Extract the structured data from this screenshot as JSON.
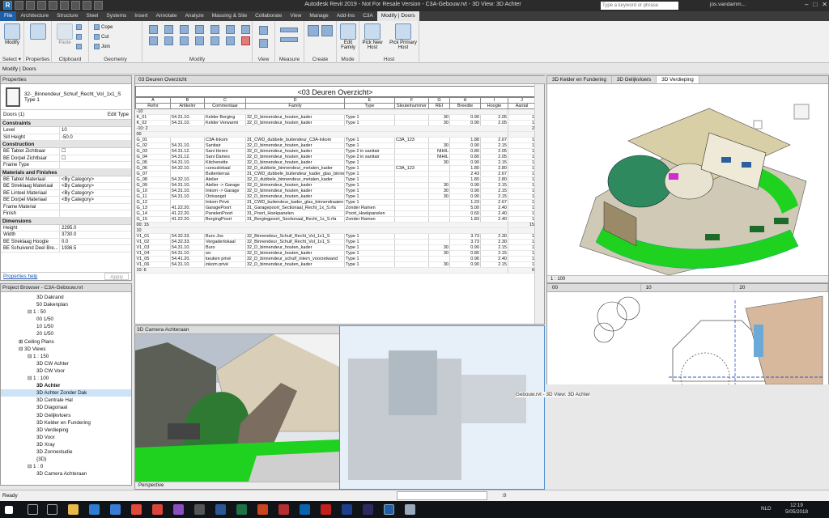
{
  "titlebar": {
    "title": "Autodesk Revit 2019 - Not For Resale Version - C3A-Gebouw.rvt - 3D View: 3D Achter",
    "search_placeholder": "Type a keyword or phrase",
    "user": "jos.vandamm..."
  },
  "tabs": [
    "File",
    "Architecture",
    "Structure",
    "Steel",
    "Systems",
    "Insert",
    "Annotate",
    "Analyze",
    "Massing & Site",
    "Collaborate",
    "View",
    "Manage",
    "Add-Ins",
    "C3A",
    "Modify | Doors"
  ],
  "context_label": "Modify | Doors",
  "ribbon": {
    "groups": [
      "Select",
      "Properties",
      "Clipboard",
      "Geometry",
      "Modify",
      "View",
      "Measure",
      "Create",
      "Mode",
      "Host"
    ],
    "select_btn": "Modify",
    "select_label": "Select ▾",
    "properties_btn": "Properties",
    "paste_btn": "Paste",
    "cope": "Cope",
    "cut": "Cut",
    "join": "Join",
    "edit_family": "Edit Family",
    "pick_new_host": "Pick New Host",
    "pick_primary_host": "Pick Primary Host"
  },
  "properties": {
    "header": "Properties",
    "type_name": "32-_Binnendeur_Schuif_Recht_Vol_1x1_S",
    "type_sub": "Type 1",
    "instance_filter": "Doors (1)",
    "edit_type": "Edit Type",
    "rows": [
      {
        "section": "Constraints"
      },
      {
        "k": "Level",
        "v": "10"
      },
      {
        "k": "Sill Height",
        "v": "-50.0"
      },
      {
        "section": "Construction"
      },
      {
        "k": "BE Tablet Zichtbaar",
        "v": "☐"
      },
      {
        "k": "BE Dorpel Zichtbaar",
        "v": "☐"
      },
      {
        "k": "Frame Type",
        "v": ""
      },
      {
        "section": "Materials and Finishes"
      },
      {
        "k": "BE Tablet Materiaal",
        "v": "<By Category>"
      },
      {
        "k": "BE Streklaag Materiaal",
        "v": "<By Category>"
      },
      {
        "k": "BE Linteel Materiaal",
        "v": "<By Category>"
      },
      {
        "k": "BE Dorpel Materiaal",
        "v": "<By Category>"
      },
      {
        "k": "Frame Material",
        "v": ""
      },
      {
        "k": "Finish",
        "v": ""
      },
      {
        "section": "Dimensions"
      },
      {
        "k": "Height",
        "v": "2295.0"
      },
      {
        "k": "Width",
        "v": "3730.0"
      },
      {
        "k": "BE Streklaag Hoogte",
        "v": "0.0"
      },
      {
        "k": "BE Schuivend Deel Bre...",
        "v": "1936.5"
      }
    ],
    "help": "Properties help",
    "apply": "Apply"
  },
  "browser": {
    "header": "Project Browser - C3A-Gebouw.rvt",
    "items": [
      {
        "t": "3D Dakrand",
        "d": 4
      },
      {
        "t": "50 Dakenplan",
        "d": 4
      },
      {
        "t": "⊟ 1 : 50",
        "d": 3
      },
      {
        "t": "00 1/50",
        "d": 4
      },
      {
        "t": "10 1/50",
        "d": 4
      },
      {
        "t": "20 1/50",
        "d": 4
      },
      {
        "t": "⊞ Ceiling Plans",
        "d": 2
      },
      {
        "t": "⊟ 3D Views",
        "d": 2
      },
      {
        "t": "⊟ 1 : 150",
        "d": 3
      },
      {
        "t": "3D CW Achter",
        "d": 4
      },
      {
        "t": "3D CW Voor",
        "d": 4
      },
      {
        "t": "⊟ 1 : 100",
        "d": 3
      },
      {
        "t": "3D Achter",
        "d": 4,
        "b": true
      },
      {
        "t": "3D Achter Zonder Dak",
        "d": 4,
        "sel": true
      },
      {
        "t": "3D Centrale Hal",
        "d": 4
      },
      {
        "t": "3D Diagonaal",
        "d": 4
      },
      {
        "t": "3D Gelijkvloers",
        "d": 4
      },
      {
        "t": "3D Kelder en Fundering",
        "d": 4
      },
      {
        "t": "3D Verdieping",
        "d": 4
      },
      {
        "t": "3D Voor",
        "d": 4
      },
      {
        "t": "3D Xray",
        "d": 4
      },
      {
        "t": "3D Zonnestudie",
        "d": 4
      },
      {
        "t": "{3D}",
        "d": 4
      },
      {
        "t": "⊟ 1 : 0",
        "d": 3
      },
      {
        "t": "3D Camera Achteraan",
        "d": 4
      }
    ]
  },
  "schedule": {
    "tab": "03 Deuren Overzicht",
    "title": "<03 Deuren Overzicht>",
    "letters": [
      "A",
      "B",
      "C",
      "D",
      "E",
      "F",
      "G",
      "H",
      "I",
      "J"
    ],
    "headers": [
      "Refnr",
      "Artikelnr",
      "Commentaar",
      "Family",
      "Type",
      "Sleutelnummer",
      "REI",
      "Breedte",
      "Hoogte",
      "Aantal"
    ],
    "rows": [
      {
        "g": "-10"
      },
      [
        "K_01",
        "54.31.10.",
        "Kelder Berging",
        "32_D_binnendeur_houten_kader",
        "Type 1",
        "",
        "30",
        "0.90",
        "2.05",
        "1"
      ],
      [
        "K_02",
        "54.31.10.",
        "Kelder Verwarmi",
        "32_D_binnendeur_houten_kader",
        "Type 1",
        "",
        "30",
        "0.90",
        "2.05",
        "1"
      ],
      {
        "g": "-10: 2",
        "n": "2"
      },
      {
        "g": "00"
      },
      [
        "G_01",
        "",
        "C3A-Inkom",
        "31_CWD_dubbele_buitendeur_C3A-inkom",
        "Type 1",
        "C3A_123",
        "",
        "1.88",
        "2.67",
        "1"
      ],
      [
        "G_02",
        "54.31.10.",
        "Sanitair",
        "32_D_binnendeur_houten_kader",
        "Type 1",
        "",
        "30",
        "0.90",
        "2.15",
        "1"
      ],
      [
        "G_03",
        "54.31.12.",
        "Sani Heren",
        "32_D_binnendeur_houten_kader",
        "Type 2 in sanitair",
        "",
        "NIHIL",
        "0.80",
        "2.05",
        "1"
      ],
      [
        "G_04",
        "54.31.12.",
        "Sani Dames",
        "32_D_binnendeur_houten_kader",
        "Type 2 in sanitair",
        "",
        "NIHIL",
        "0.80",
        "2.05",
        "1"
      ],
      [
        "G_05",
        "54.31.10.",
        "Kitchenette",
        "32_D_binnendeur_houten_kader",
        "Type 1",
        "",
        "30",
        "0.90",
        "2.15",
        "1"
      ],
      [
        "G_06",
        "54.32.10.",
        "cursuslokaal",
        "32_D_dubbele_binnendeur_metalen_kader",
        "Type 1",
        "C3A_123",
        "",
        "1.80",
        "2.80",
        "1"
      ],
      [
        "G_07",
        "",
        "Buitenterras",
        "31_CWD_dubbele_buitendeur_kader_glas_binne",
        "Type 1",
        "",
        "",
        "2.43",
        "2.67",
        "1"
      ],
      [
        "G_08",
        "54.32.10.",
        "Atelier",
        "32_D_dubbele_binnendeur_metalen_kader",
        "Type 1",
        "",
        "",
        "1.80",
        "2.80",
        "1"
      ],
      [
        "G_09",
        "54.31.10.",
        "Atelier -> Garage",
        "32_D_binnendeur_houten_kader",
        "Type 1",
        "",
        "30",
        "0.90",
        "2.15",
        "1"
      ],
      [
        "G_10",
        "54.31.10.",
        "Inkom -> Garage",
        "32_D_binnendeur_houten_kader",
        "Type 1",
        "",
        "30",
        "0.90",
        "2.15",
        "1"
      ],
      [
        "G_11",
        "54.31.10.",
        "Ontvangst",
        "32_D_binnendeur_houten_kader",
        "Type 1",
        "",
        "30",
        "0.90",
        "2.15",
        "1"
      ],
      [
        "G_12",
        "",
        "Inkom Privé",
        "31_CWD_buitendeur_kader_glas_binnendraaien",
        "Type 1",
        "",
        "",
        "1.23",
        "2.67",
        "1"
      ],
      [
        "G_13",
        "41.22.20.",
        "GaragePoort",
        "31_Garagepoort_Sectionaal_Recht_1x_S.rfa",
        "Zonder Ramen",
        "",
        "",
        "5.00",
        "2.40",
        "1"
      ],
      [
        "G_14",
        "41.22.20.",
        "PanelenPoort",
        "31_Poort_Hoekpanelen",
        "Poort_Hoekpanelen",
        "",
        "",
        "0.60",
        "2.40",
        "1"
      ],
      [
        "G_15",
        "41.22.20.",
        "BergingPoort",
        "31_Bergingpoort_Sectionaal_Recht_1x_S.rfa",
        "Zonder Ramen",
        "",
        "",
        "1.83",
        "2.40",
        "1"
      ],
      {
        "g": "00: 15",
        "n": "15"
      },
      {
        "g": "10"
      },
      [
        "V1_01",
        "54.32.33.",
        "Buro Jos",
        "32_Binnendeur_Schuif_Recht_Vol_1x1_S",
        "Type 1",
        "",
        "",
        "3.73",
        "2.30",
        "1"
      ],
      [
        "V1_02",
        "54.32.33.",
        "Vergaderlokaal",
        "32_Binnendeur_Schuif_Recht_Vol_1x1_S",
        "Type 1",
        "",
        "",
        "3.73",
        "2.30",
        "1"
      ],
      [
        "V1_03",
        "54.31.10.",
        "Buro",
        "32_D_binnendeur_houten_kader",
        "Type 1",
        "",
        "30",
        "0.90",
        "2.15",
        "1"
      ],
      [
        "V1_04",
        "54.31.10.",
        "wc",
        "32_D_binnendeur_houten_kader",
        "Type 1",
        "",
        "30",
        "0.80",
        "2.15",
        "1"
      ],
      [
        "V1_05",
        "54.41.20.",
        "keuken privé",
        "32_D_binnendeur_schuif_intern_voorzetwand",
        "Type 1",
        "",
        "",
        "0.96",
        "2.40",
        "1"
      ],
      [
        "V1_06",
        "54.31.10.",
        "inkom privé",
        "32_D_binnendeur_houten_kader",
        "Type 1",
        "",
        "30",
        "0.90",
        "2.15",
        "1"
      ],
      {
        "g": "10: 6",
        "n": "6"
      }
    ]
  },
  "view3d": {
    "tabs": [
      "3D Kelder en Fundering",
      "3D Gelijkvloers",
      "3D Verdieping"
    ],
    "scale": "1 : 100"
  },
  "planview": {
    "tabs": [
      "00",
      "10",
      "20"
    ],
    "scale": "1 : 100"
  },
  "camera": {
    "tab": "3D Camera Achteraan",
    "bar": "Perspective"
  },
  "ghost_label": "Gebouw.rvt - 3D View: 3D Achter",
  "status": {
    "text": "Ready",
    "zoom": ":0"
  },
  "taskbar": {
    "time": "12:19",
    "date": "5/05/2018",
    "lang": "NLD"
  },
  "colors": {
    "revit_blue": "#1e5fa8",
    "ground_green": "#1fd21f",
    "selection_blue": "#4f8fd0"
  }
}
